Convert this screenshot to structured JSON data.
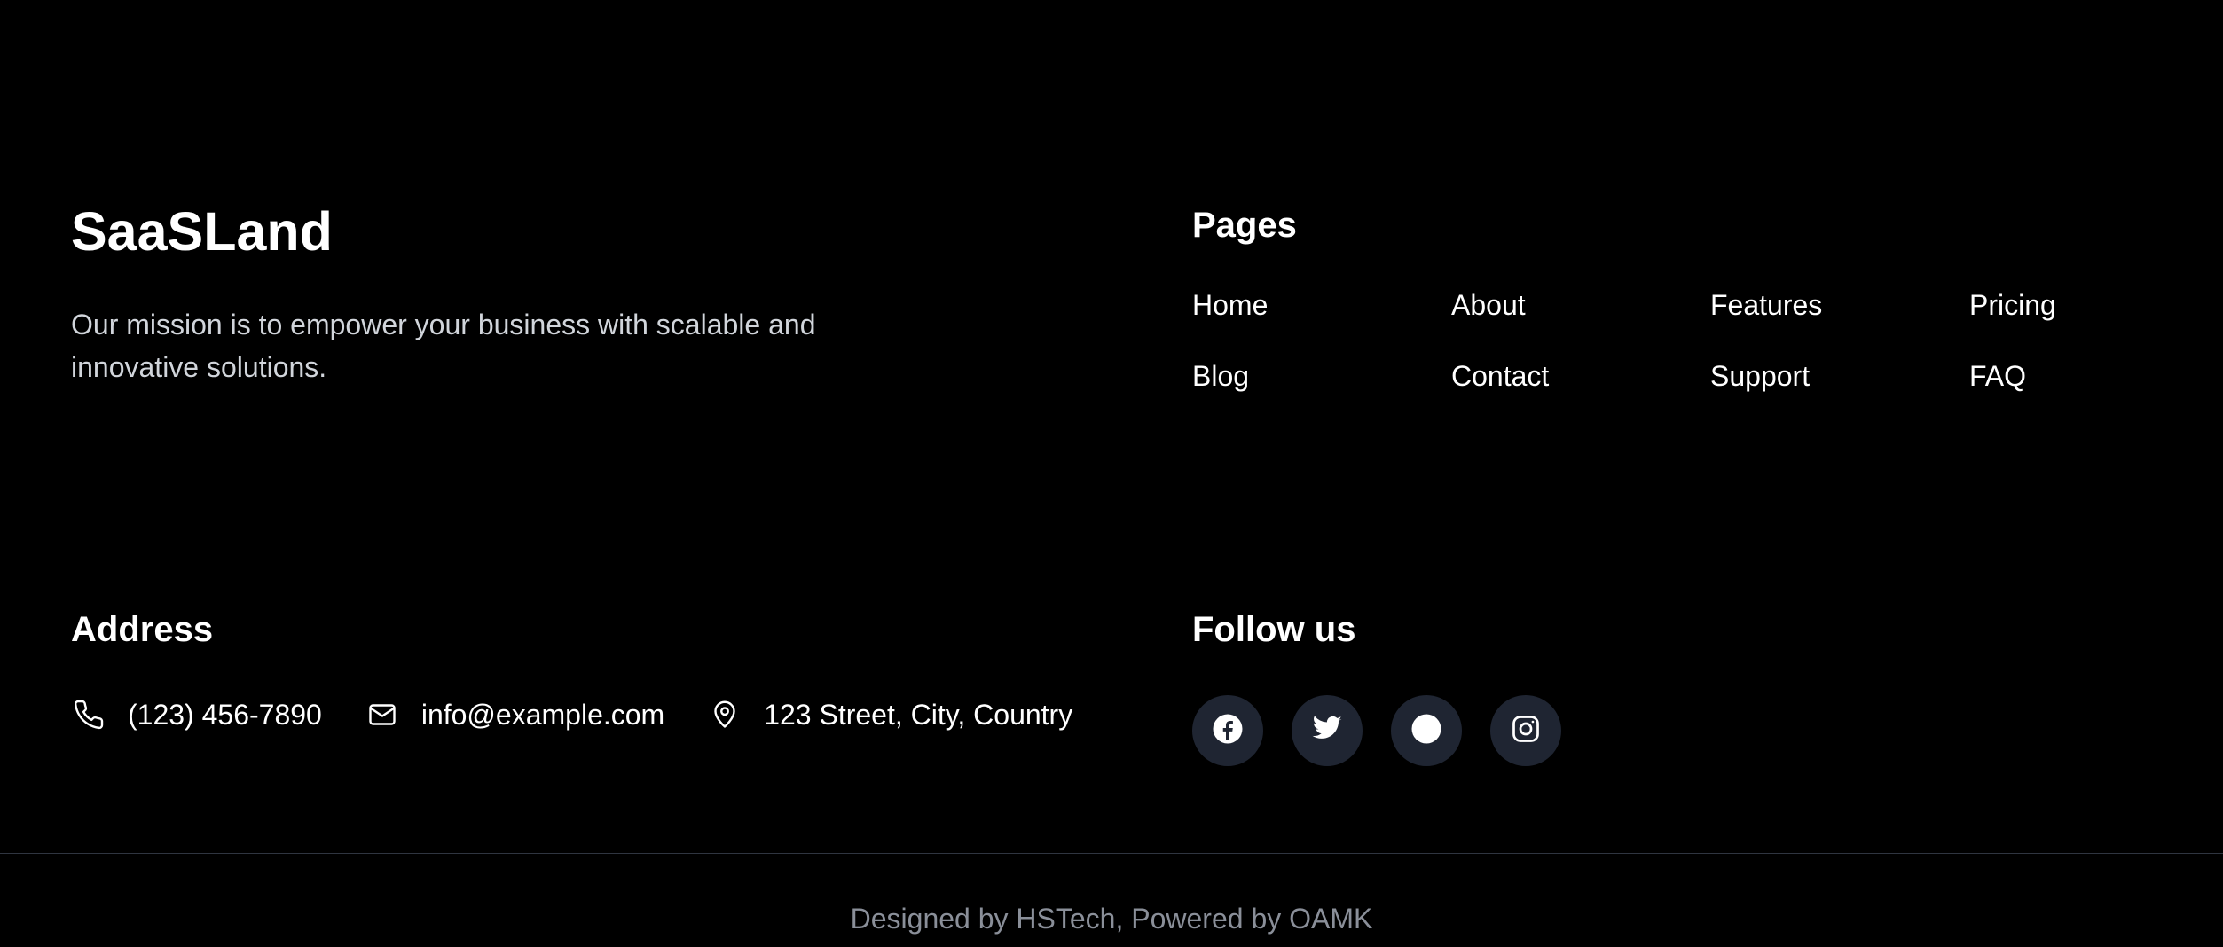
{
  "brand": {
    "name": "SaaSLand",
    "description": "Our mission is to empower your business with scalable and innovative solutions."
  },
  "pages": {
    "heading": "Pages",
    "links": [
      {
        "label": "Home"
      },
      {
        "label": "About"
      },
      {
        "label": "Features"
      },
      {
        "label": "Pricing"
      },
      {
        "label": "Blog"
      },
      {
        "label": "Contact"
      },
      {
        "label": "Support"
      },
      {
        "label": "FAQ"
      }
    ]
  },
  "address": {
    "heading": "Address",
    "phone": "(123) 456-7890",
    "email": "info@example.com",
    "location": "123 Street, City, Country",
    "icons": [
      "phone-icon",
      "mail-icon",
      "map-pin-icon"
    ]
  },
  "follow": {
    "heading": "Follow us",
    "socials": [
      "facebook-icon",
      "twitter-icon",
      "circle-icon",
      "instagram-icon"
    ]
  },
  "credits": "Designed by HSTech, Powered by OAMK",
  "colors": {
    "background": "#000000",
    "text": "#ffffff",
    "muted_text": "#d1d5db",
    "credits_text": "#8a8f99",
    "social_bg": "#1f2532",
    "divider": "#2f3540"
  }
}
